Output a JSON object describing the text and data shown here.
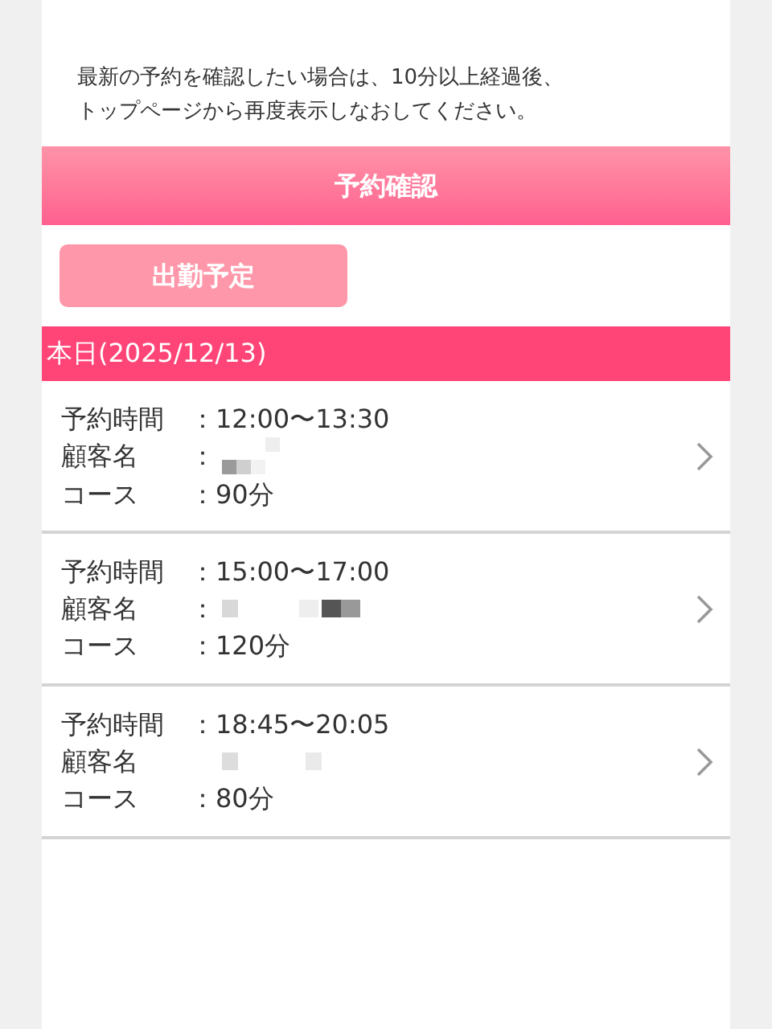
{
  "notice": [
    "最新の予約を確認したい場合は、10分以上経過後、",
    "トップページから再度表示しなおしてください。"
  ],
  "header": {
    "title": "予約確認"
  },
  "schedule_button": {
    "label": "出勤予定"
  },
  "date_bar": {
    "label": "本日(2025/12/13)"
  },
  "reservations": [
    {
      "time_label": "予約時間",
      "time": "：12:00〜13:30",
      "customer_label": "顧客名",
      "customer": "：",
      "course_label": "コース",
      "course": "：90分"
    },
    {
      "time_label": "予約時間",
      "time": "：15:00〜17:00",
      "customer_label": "顧客名",
      "customer": "：",
      "course_label": "コース",
      "course": "：120分"
    },
    {
      "time_label": "予約時間",
      "time": "：18:45〜20:05",
      "customer_label": "顧客名",
      "course_label": "コース",
      "course": "：80分"
    }
  ]
}
